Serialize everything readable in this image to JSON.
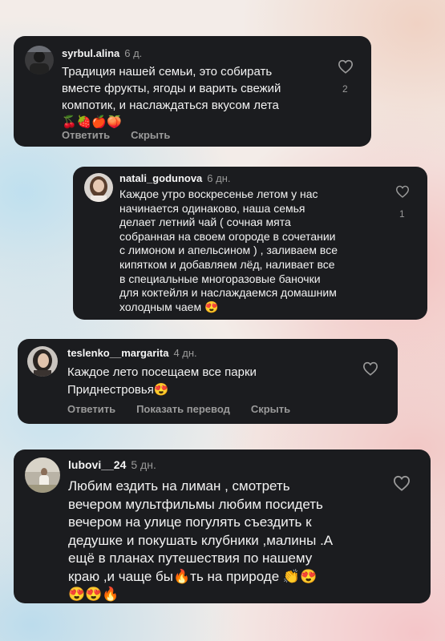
{
  "comments": [
    {
      "username": "syrbul.alina",
      "time": "6 д.",
      "lines": [
        "Традиция нашей семьи, это собирать",
        "вместе фрукты, ягоды и варить свежий",
        "компотик, и наслаждаться вкусом лета",
        "🍒🍓🍎🍑"
      ],
      "actions": [
        "Ответить",
        "Скрыть"
      ],
      "likes": "2"
    },
    {
      "username": "natali_godunova",
      "time": "6 дн.",
      "lines": [
        "Каждое утро воскресенье летом у нас",
        "начинается одинаково, наша семья",
        "делает летний чай ( сочная мята",
        "собранная на своем огороде в сочетании",
        "с лимоном и апельсином ) , заливаем все",
        "кипятком и добавляем лёд, наливает все",
        "в специальные многоразовые баночки",
        "для коктейля и наслаждаемся домашним",
        "холодным чаем 😍"
      ],
      "likes": "1"
    },
    {
      "username": "teslenko__margarita",
      "time": "4 дн.",
      "lines": [
        "Каждое лето посещаем все парки",
        "Приднестровья😍"
      ],
      "actions": [
        "Ответить",
        "Показать перевод",
        "Скрыть"
      ]
    },
    {
      "username": "lubovi__24",
      "time": "5 дн.",
      "lines": [
        "Любим ездить на лиман , смотреть",
        "вечером мультфильмы любим посидеть",
        "вечером на улице погулять съездить к",
        "дедушке и покушать клубники ,малины .А",
        "ещё в планах путешествия по нашему",
        "краю ,и чаще бы🔥ть на природе 👏😍",
        "😍😍🔥"
      ]
    }
  ],
  "icons": {
    "like": "heart-outline-icon"
  },
  "colors": {
    "card": "#1b1c1f",
    "muted": "#9a9a9a",
    "text": "#f2f2f2"
  }
}
